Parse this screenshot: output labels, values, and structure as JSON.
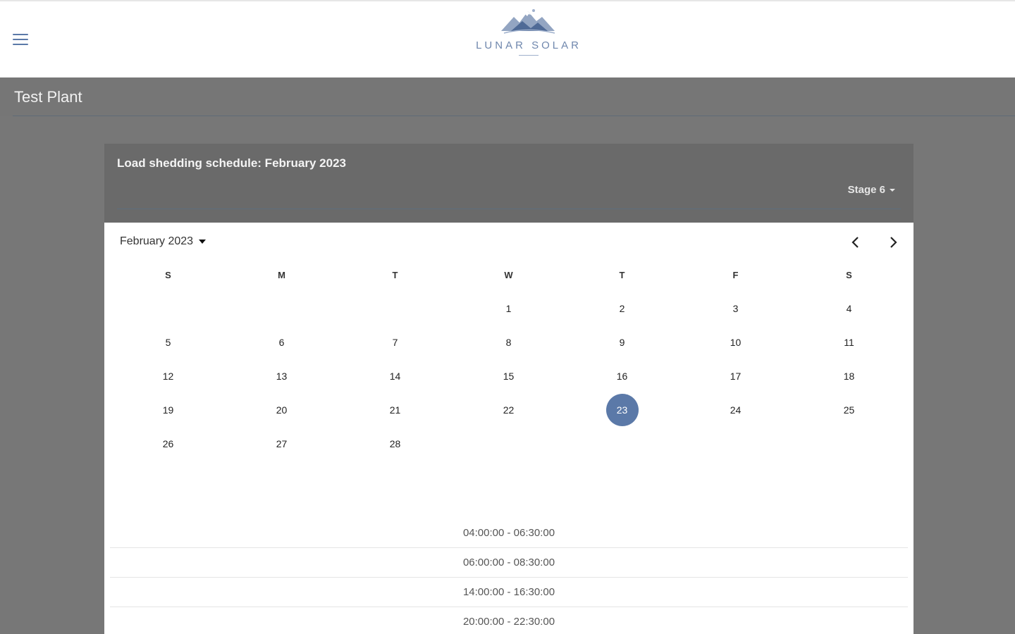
{
  "header": {
    "menu_icon": "hamburger-menu-icon",
    "logo_text": "LUNAR SOLAR",
    "accent_color": "#5b79a8"
  },
  "plant": {
    "title": "Test Plant"
  },
  "schedule": {
    "title": "Load shedding schedule: February 2023",
    "stage": "Stage 6"
  },
  "calendar": {
    "month_label": "February 2023",
    "weekdays": [
      "S",
      "M",
      "T",
      "W",
      "T",
      "F",
      "S"
    ],
    "weeks": [
      [
        "",
        "",
        "",
        "1",
        "2",
        "3",
        "4"
      ],
      [
        "5",
        "6",
        "7",
        "8",
        "9",
        "10",
        "11"
      ],
      [
        "12",
        "13",
        "14",
        "15",
        "16",
        "17",
        "18"
      ],
      [
        "19",
        "20",
        "21",
        "22",
        "23",
        "24",
        "25"
      ],
      [
        "26",
        "27",
        "28",
        "",
        "",
        "",
        ""
      ]
    ],
    "selected_day": "23"
  },
  "time_slots": [
    "04:00:00 - 06:30:00",
    "06:00:00 - 08:30:00",
    "14:00:00 - 16:30:00",
    "20:00:00 - 22:30:00"
  ]
}
